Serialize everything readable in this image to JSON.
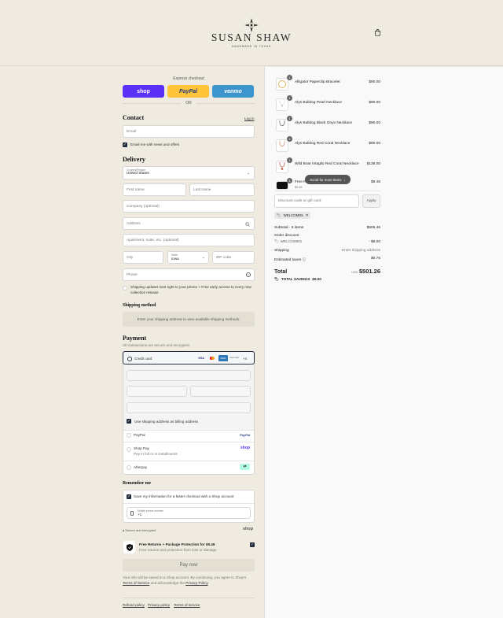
{
  "header": {
    "brand": "SUSAN SHAW",
    "tagline": "HANDMADE IN TEXAS",
    "cart_icon": "bag-icon"
  },
  "express": {
    "label": "Express checkout",
    "shop_label": "shop",
    "paypal_label": "PayPal",
    "venmo_label": "venmo",
    "or_label": "OR",
    "colors": {
      "shop": "#5a31f4",
      "paypal": "#ffc439",
      "venmo": "#3d95ce"
    }
  },
  "contact": {
    "title": "Contact",
    "login_label": "Log in",
    "email_placeholder": "Email",
    "news_label": "Email me with news and offers"
  },
  "delivery": {
    "title": "Delivery",
    "country_label": "Country/Region",
    "country_value": "United States",
    "first_name": "First name",
    "last_name": "Last name",
    "company": "Company (optional)",
    "address": "Address",
    "apartment": "Apartment, suite, etc. (optional)",
    "city": "City",
    "state_label": "State",
    "state_value": "Iowa",
    "zip": "ZIP code",
    "phone": "Phone",
    "sms_label": "Shipping updates sent right to your phone + Free early access to every new collection release"
  },
  "shipping_method": {
    "title": "Shipping method",
    "notice": "Enter your shipping address to view available shipping methods."
  },
  "payment": {
    "title": "Payment",
    "subtitle": "All transactions are secure and encrypted.",
    "credit_card_label": "Credit card",
    "card_brands": [
      "VISA",
      "MC",
      "AMEX",
      "DISCOVER"
    ],
    "more_cards": "+4",
    "billing_label": "Use shipping address as billing address",
    "paypal_label": "PayPal",
    "paypal_logo": "PayPal",
    "shoppay_label": "Shop Pay",
    "shoppay_sub": "Pay in full or in installments",
    "shoppay_logo": "shop",
    "afterpay_label": "Afterpay"
  },
  "remember": {
    "title": "Remember me",
    "save_label": "Save my information for a faster checkout with a Shop account",
    "mobile_label": "Mobile phone number",
    "mobile_value": "+1",
    "secure_label": "Secure and encrypted",
    "shop_logo": "shop"
  },
  "protection": {
    "title": "Free Returns + Package Protection for $9.46",
    "subtitle": "Free returns and protection from loss or damage"
  },
  "pay_now_label": "Pay now",
  "legal": {
    "text_1": "Your info will be saved to a Shop account. By continuing, you agree to Shop's",
    "tos": "Terms of Service",
    "text_2": "and acknowledge the",
    "privacy": "Privacy Policy"
  },
  "footer_links": [
    "Refund policy",
    "Privacy policy",
    "Terms of service"
  ],
  "cart": {
    "items": [
      {
        "name": "Alligator Paperclip Bracelet",
        "price": "$90.00",
        "qty": "1"
      },
      {
        "name": "Alys Bulldog Pearl Necklace",
        "price": "$90.00",
        "qty": "1"
      },
      {
        "name": "Alys Bulldog Black Onyx Necklace",
        "price": "$90.00",
        "qty": "1"
      },
      {
        "name": "Alys Bulldog Red Coral Necklace",
        "price": "$90.00",
        "qty": "1"
      },
      {
        "name": "Wild Boar Intaglio Red Coral Necklace",
        "price": "$136.00",
        "qty": "1"
      },
      {
        "name": "Free R",
        "sub": "$9.46",
        "price": "$9.46",
        "qty": "1"
      }
    ],
    "scroll_hint": "Scroll for more items",
    "discount_placeholder": "Discount code or gift card",
    "apply_label": "Apply",
    "applied_code": "WELCOME5",
    "subtotal_label": "Subtotal · 6 items",
    "subtotal_value": "$505.46",
    "order_discount_label": "Order discount",
    "discount_code": "WELCOME5",
    "discount_value": "- $5.00",
    "shipping_label": "Shipping",
    "shipping_value": "Enter shipping address",
    "taxes_label": "Estimated taxes",
    "taxes_value": "$0.76",
    "total_label": "Total",
    "currency": "USD",
    "total_value": "$501.26",
    "savings_label": "TOTAL SAVINGS",
    "savings_value": "$5.00"
  }
}
